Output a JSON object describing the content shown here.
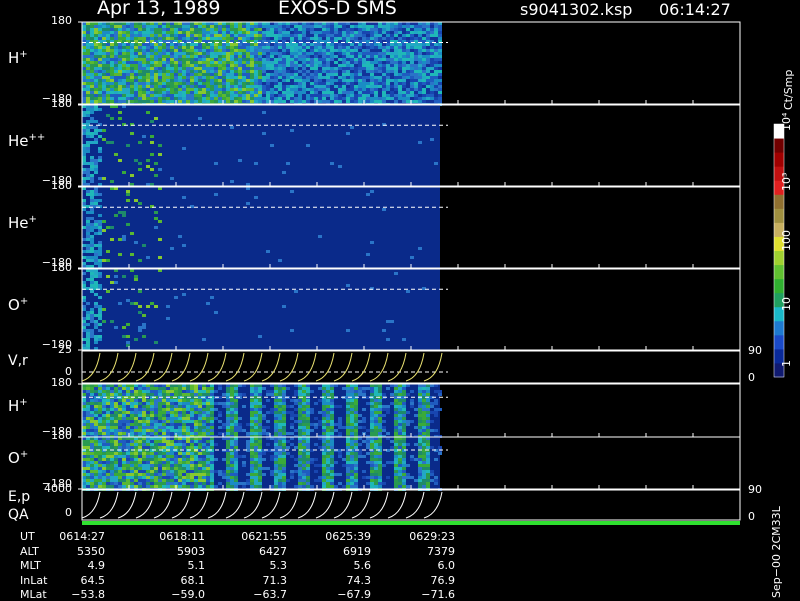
{
  "header": {
    "date": "Apr 13, 1989",
    "instrument": "EXOS-D SMS",
    "file": "s9041302.ksp",
    "time": "06:14:27"
  },
  "colors": {
    "axis": "#ffffff",
    "background": "#000000",
    "empty": "#0a2a8a",
    "ref_line": "#ffffff",
    "vr_curve": "#e8e070",
    "ep_curve": "#ffffff",
    "qa_bar": "#30e030"
  },
  "colorbar": {
    "unit": "Ct/Smp",
    "ticks": [
      "1",
      "10",
      "100",
      "10³",
      "10⁴"
    ],
    "colors": [
      "#101a70",
      "#0a2a9a",
      "#1a4ac8",
      "#1e7ad0",
      "#1ab8c8",
      "#20a060",
      "#30b030",
      "#60c030",
      "#a0d030",
      "#e0e030",
      "#c8b060",
      "#a09040",
      "#907030",
      "#e02020",
      "#c01010",
      "#a00000",
      "#700000",
      "#ffffff"
    ]
  },
  "panels": [
    {
      "id": "h-plus-1",
      "species": "H",
      "charge": "+",
      "ymax": "180",
      "ymin": "−180",
      "density": "high"
    },
    {
      "id": "he-plus-plus",
      "species": "He",
      "charge": "++",
      "ymax": "180",
      "ymin": "−180",
      "density": "low"
    },
    {
      "id": "he-plus",
      "species": "He",
      "charge": "+",
      "ymax": "180",
      "ymin": "−180",
      "density": "low"
    },
    {
      "id": "o-plus-1",
      "species": "O",
      "charge": "+",
      "ymax": "180",
      "ymin": "−180",
      "density": "low"
    },
    {
      "id": "h-plus-2",
      "species": "H",
      "charge": "+",
      "ymax": "180",
      "ymin": "−180",
      "density": "stripes"
    },
    {
      "id": "o-plus-2",
      "species": "O",
      "charge": "+",
      "ymax": "180",
      "ymin": "−180",
      "density": "stripes"
    }
  ],
  "vr_panel": {
    "label": "V,r",
    "ymax": "25",
    "ymin": "0",
    "right_max": "90",
    "right_min": "0"
  },
  "ep_panel": {
    "label1": "E,p",
    "label2": "QA",
    "ymax": "4000",
    "ymin": "0",
    "right_max": "90",
    "right_min": "0"
  },
  "orbit_table": {
    "row_labels": [
      "UT",
      "ALT",
      "MLT",
      "InLat",
      "MLat"
    ],
    "columns": [
      {
        "UT": "0614:27",
        "ALT": "5350",
        "MLT": "4.9",
        "InLat": "64.5",
        "MLat": "−53.8"
      },
      {
        "UT": "0618:11",
        "ALT": "5903",
        "MLT": "5.1",
        "InLat": "68.1",
        "MLat": "−59.0"
      },
      {
        "UT": "0621:55",
        "ALT": "6427",
        "MLT": "5.3",
        "InLat": "71.3",
        "MLat": "−63.7"
      },
      {
        "UT": "0625:39",
        "ALT": "6919",
        "MLT": "5.6",
        "InLat": "74.3",
        "MLat": "−67.9"
      },
      {
        "UT": "0629:23",
        "ALT": "7379",
        "MLT": "6.0",
        "InLat": "76.9",
        "MLat": "−71.6"
      }
    ]
  },
  "footer_note": "Sep−00 2CM33L",
  "chart_data": {
    "type": "heatmap",
    "title": "Apr 13, 1989 EXOS-D SMS s9041302.ksp 06:14:27",
    "x_ticks": [
      "0614:27",
      "0618:11",
      "0621:55",
      "0625:39",
      "0629:23"
    ],
    "ylim": [
      -180,
      180
    ],
    "z_scale": "log",
    "z_range": [
      1,
      10000
    ],
    "z_label": "Ct/Smp",
    "series": [
      {
        "name": "H+"
      },
      {
        "name": "He++"
      },
      {
        "name": "He+"
      },
      {
        "name": "O+"
      },
      {
        "name": "V,r"
      },
      {
        "name": "H+"
      },
      {
        "name": "O+"
      },
      {
        "name": "E,p"
      }
    ]
  }
}
